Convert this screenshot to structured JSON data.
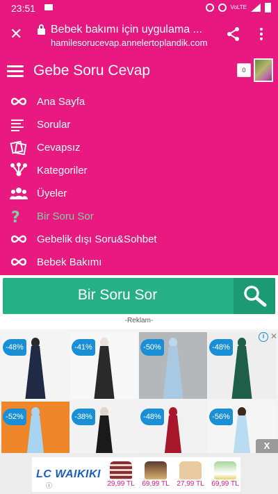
{
  "status_bar": {
    "time": "23:51",
    "network_label": "VoLTE"
  },
  "browser": {
    "page_title": "Bebek bakımı için uygulama ...",
    "url": "hamilesorucevap.annelertoplandik.com"
  },
  "site": {
    "title": "Gebe Soru Cevap",
    "notification_count": "0"
  },
  "menu": {
    "items": [
      {
        "label": "Ana Sayfa",
        "icon": "infinity-icon"
      },
      {
        "label": "Sorular",
        "icon": "lines-icon"
      },
      {
        "label": "Cevapsız",
        "icon": "cards-icon"
      },
      {
        "label": "Kategoriler",
        "icon": "tree-icon"
      },
      {
        "label": "Üyeler",
        "icon": "users-icon"
      },
      {
        "label": "Bir Soru Sor",
        "icon": "question-icon"
      },
      {
        "label": "Gebelik dışı Soru&Sohbet",
        "icon": "infinity-icon"
      },
      {
        "label": "Bebek Bakımı",
        "icon": "infinity-icon"
      }
    ]
  },
  "ask_bar": {
    "label": "Bir Soru Sor"
  },
  "ad": {
    "label": "-Reklam-",
    "info_icon": "i",
    "close_small": "✕",
    "close_label": "X",
    "products": [
      {
        "discount": "-48%",
        "dress_color": "#1f2a44"
      },
      {
        "discount": "-41%",
        "dress_color": "#2a2a2a"
      },
      {
        "discount": "-50%",
        "dress_color": "#a9c9e2"
      },
      {
        "discount": "-48%",
        "dress_color": "#1f5e48"
      },
      {
        "discount": "-52%",
        "dress_color": "#a7d4f0"
      },
      {
        "discount": "-38%",
        "dress_color": "#1a1a1a"
      },
      {
        "discount": "-48%",
        "dress_color": "#a8162a"
      },
      {
        "discount": "-56%",
        "dress_color": "#b9dcf2"
      }
    ]
  },
  "banner": {
    "brand": "LC WAIKIKI",
    "items": [
      {
        "price": "29,99 TL",
        "color": "#8a2b3a"
      },
      {
        "price": "69,99 TL",
        "color": "#5a3a2a"
      },
      {
        "price": "27,99 TL",
        "color": "#e9c9a0"
      },
      {
        "price": "69,99 TL",
        "color": "#a8d69a"
      }
    ]
  },
  "colors": {
    "brand_pink": "#e8197f",
    "ask_green": "#27b084",
    "highlight_green": "#7ed0a4",
    "discount_blue": "#1a8fd6"
  }
}
